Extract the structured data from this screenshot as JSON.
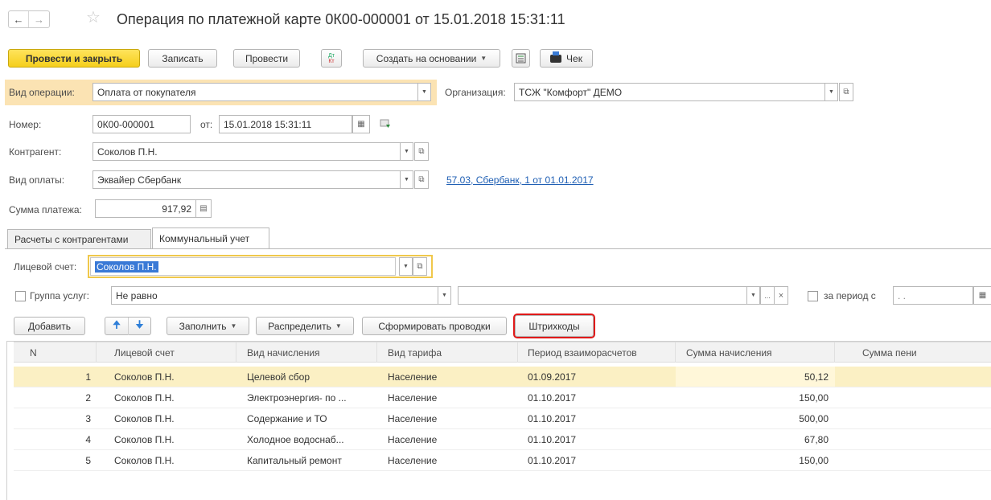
{
  "window": {
    "title": "Операция по платежной карте 0К00-000001 от 15.01.2018 15:31:11"
  },
  "toolbar": {
    "post_close": "Провести и закрыть",
    "save": "Записать",
    "post": "Провести",
    "dtkt_top": "Дт",
    "dtkt_bottom": "Кт",
    "create_based": "Создать на основании",
    "receipt": "Чек"
  },
  "form": {
    "operation_label": "Вид операции:",
    "operation_value": "Оплата от покупателя",
    "org_label": "Организация:",
    "org_value": "ТСЖ \"Комфорт\" ДЕМО",
    "number_label": "Номер:",
    "number_value": "0К00-000001",
    "date_label": "от:",
    "date_value": "15.01.2018 15:31:11",
    "counterparty_label": "Контрагент:",
    "counterparty_value": "Соколов П.Н.",
    "payment_type_label": "Вид оплаты:",
    "payment_type_value": "Эквайер Сбербанк",
    "contract_link": "57.03, Сбербанк, 1 от 01.01.2017",
    "amount_label": "Сумма платежа:",
    "amount_value": "917,92"
  },
  "tabs": [
    {
      "label": "Расчеты с контрагентами"
    },
    {
      "label": "Коммунальный учет"
    }
  ],
  "utility": {
    "account_label": "Лицевой счет:",
    "account_value": "Соколов П.Н.",
    "service_group_label": "Группа услуг:",
    "service_group_cond": "Не равно",
    "service_group_value": "",
    "period_label": "за период с",
    "period_value": " .  .",
    "ellipsis": "...",
    "clear": "×"
  },
  "table_toolbar": {
    "add": "Добавить",
    "fill": "Заполнить",
    "distribute": "Распределить",
    "form_entries": "Сформировать проводки",
    "barcodes": "Штрихкоды"
  },
  "table": {
    "columns": [
      "N",
      "Лицевой счет",
      "Вид начисления",
      "Вид тарифа",
      "Период взаиморасчетов",
      "Сумма начисления",
      "Сумма пени"
    ],
    "rows": [
      {
        "n": "1",
        "account": "Соколов П.Н.",
        "charge": "Целевой сбор",
        "tariff": "Население",
        "period": "01.09.2017",
        "amount": "50,12",
        "penalty": ""
      },
      {
        "n": "2",
        "account": "Соколов П.Н.",
        "charge": "Электроэнергия- по ...",
        "tariff": "Население",
        "period": "01.10.2017",
        "amount": "150,00",
        "penalty": ""
      },
      {
        "n": "3",
        "account": "Соколов П.Н.",
        "charge": "Содержание и ТО",
        "tariff": "Население",
        "period": "01.10.2017",
        "amount": "500,00",
        "penalty": ""
      },
      {
        "n": "4",
        "account": "Соколов П.Н.",
        "charge": "Холодное водоснаб...",
        "tariff": "Население",
        "period": "01.10.2017",
        "amount": "67,80",
        "penalty": ""
      },
      {
        "n": "5",
        "account": "Соколов П.Н.",
        "charge": "Капитальный ремонт",
        "tariff": "Население",
        "period": "01.10.2017",
        "amount": "150,00",
        "penalty": ""
      }
    ]
  },
  "colors": {
    "accent_yellow": "#f5cf1c",
    "field_highlight": "#fbe3b3",
    "selected_row": "#fbf0c4",
    "link": "#1f5fb4",
    "highlight_border": "#e01a1a"
  }
}
